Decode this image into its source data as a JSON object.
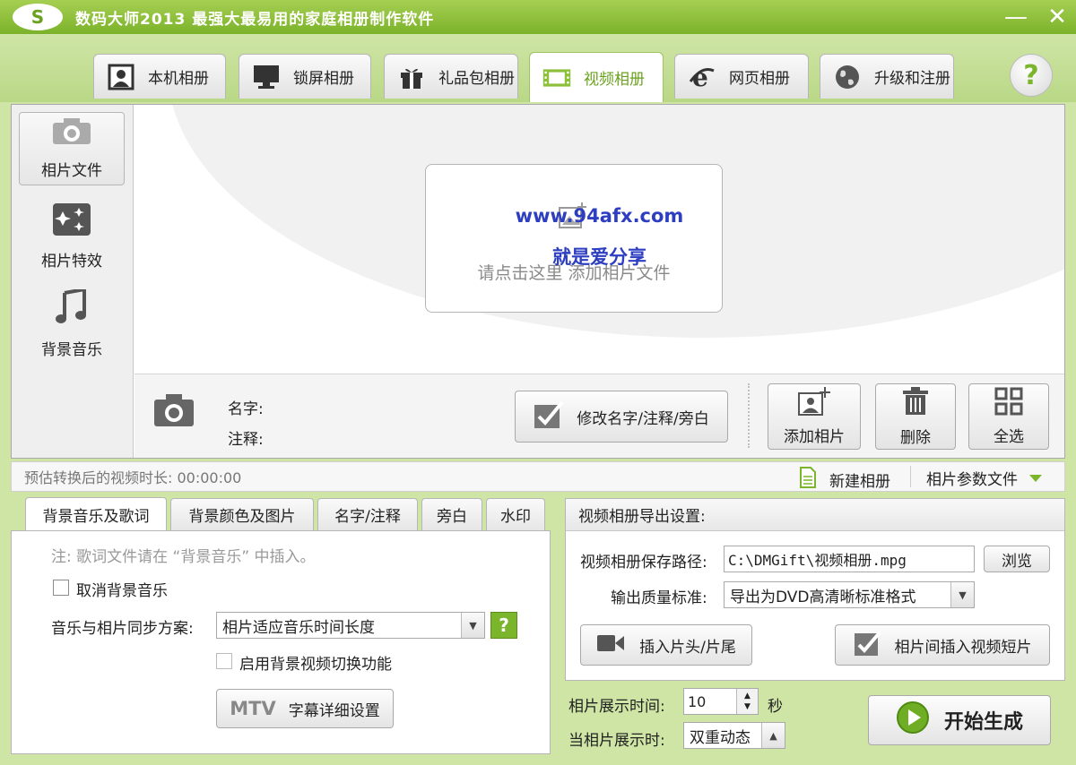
{
  "window": {
    "logo_text": "S",
    "title": "数码大师2013   最强大最易用的家庭相册制作软件",
    "minimize": "—",
    "close": "✕"
  },
  "top_tabs": [
    {
      "label": "本机相册",
      "icon": "portrait-icon"
    },
    {
      "label": "锁屏相册",
      "icon": "monitor-icon"
    },
    {
      "label": "礼品包相册",
      "icon": "gift-icon"
    },
    {
      "label": "视频相册",
      "icon": "film-icon",
      "active": true
    },
    {
      "label": "网页相册",
      "icon": "ie-icon"
    },
    {
      "label": "升级和注册",
      "icon": "globe-icon"
    }
  ],
  "help": "?",
  "sidebar": {
    "items": [
      {
        "label": "相片文件",
        "icon": "camera-icon"
      },
      {
        "label": "相片特效",
        "icon": "sparkle-icon"
      },
      {
        "label": "背景音乐",
        "icon": "music-note-icon"
      }
    ]
  },
  "canvas": {
    "watermark_url": "www.94afx.com",
    "watermark_sub": "就是爱分享",
    "add_hint": "请点击这里  添加相片文件"
  },
  "info": {
    "name_label": "名字:",
    "note_label": "注释:",
    "edit_button": "修改名字/注释/旁白",
    "add_photo": "添加相片",
    "delete": "删除",
    "select_all": "全选"
  },
  "status": {
    "duration_text": "预估转换后的视频时长: 00:00:00",
    "new_album": "新建相册",
    "param_file": "相片参数文件"
  },
  "bottom_tabs": [
    {
      "label": "背景音乐及歌词",
      "active": true
    },
    {
      "label": "背景颜色及图片"
    },
    {
      "label": "名字/注释"
    },
    {
      "label": "旁白"
    },
    {
      "label": "水印"
    }
  ],
  "music_panel": {
    "note": "注: 歌词文件请在 “背景音乐” 中插入。",
    "cancel_music": "取消背景音乐",
    "sync_label": "音乐与相片同步方案:",
    "sync_value": "相片适应音乐时间长度",
    "sync_help": "?",
    "enable_video_switch": "启用背景视频切换功能",
    "mtv_badge": "MTV",
    "subtitle_settings": "字幕详细设置"
  },
  "export_panel": {
    "header": "视频相册导出设置:",
    "path_label": "视频相册保存路径:",
    "path_value": "C:\\DMGift\\视频相册.mpg",
    "browse": "浏览",
    "quality_label": "输出质量标准:",
    "quality_value": "导出为DVD高清晰标准格式",
    "insert_head_tail": "插入片头/片尾",
    "insert_clip": "相片间插入视频短片"
  },
  "timing": {
    "display_time_label": "相片展示时间:",
    "display_time_value": "10",
    "seconds_unit": "秒",
    "display_mode_label": "当相片展示时:",
    "display_mode_value": "双重动态"
  },
  "start_button": "开始生成",
  "colors": {
    "accent": "#7ab52b",
    "titlebar": "#8cc03a",
    "watermark": "#2d3ec0"
  }
}
